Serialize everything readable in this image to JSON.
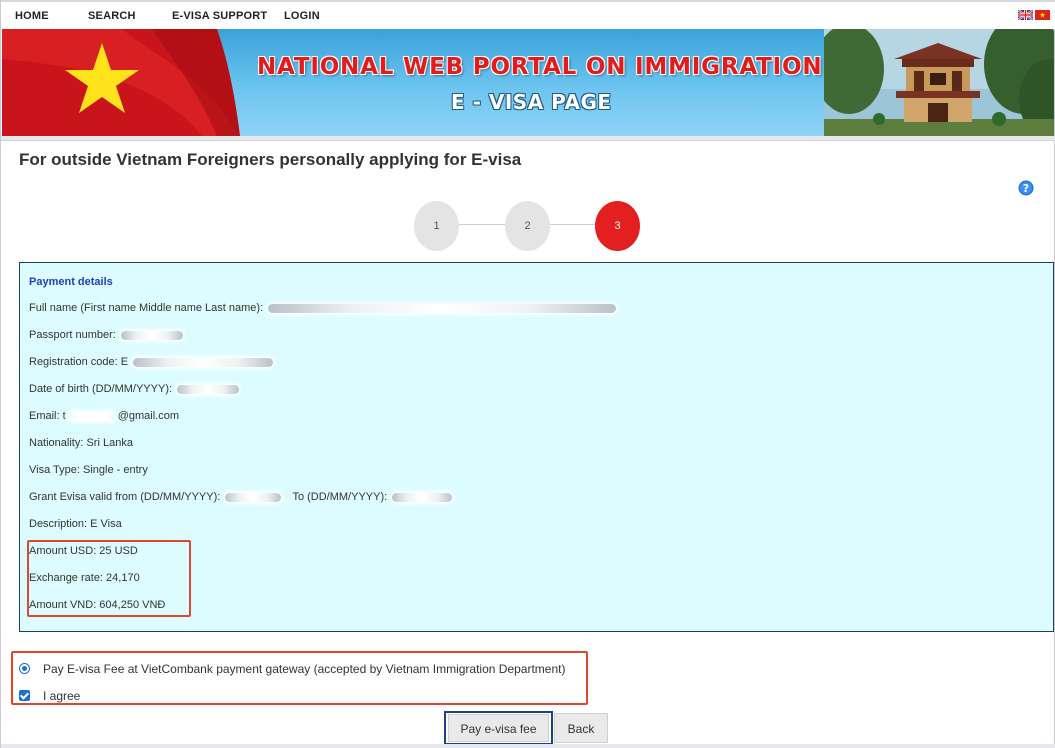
{
  "nav": {
    "home": "HOME",
    "search": "SEARCH",
    "support": "E-VISA SUPPORT",
    "login": "LOGIN"
  },
  "languages": [
    "english-flag-icon",
    "vietnam-flag-icon"
  ],
  "banner": {
    "title": "NATIONAL WEB PORTAL ON IMMIGRATION",
    "subtitle": "E - VISA PAGE"
  },
  "page": {
    "heading": "For outside Vietnam Foreigners personally applying for E-visa",
    "help_icon": "question-icon"
  },
  "steps": [
    {
      "label": "1",
      "active": false
    },
    {
      "label": "2",
      "active": false
    },
    {
      "label": "3",
      "active": true
    }
  ],
  "payment": {
    "title": "Payment details",
    "full_name_label": "Full name (First name Middle name Last name):",
    "passport_label": "Passport number:",
    "registration_label": "Registration code: E",
    "dob_label": "Date of birth (DD/MM/YYYY):",
    "email_label": "Email: t",
    "email_suffix": "@gmail.com",
    "nationality": "Nationality: Sri Lanka",
    "visa_type": "Visa Type: Single - entry",
    "grant_from_label": "Grant Evisa valid from (DD/MM/YYYY):",
    "grant_to_label": "To (DD/MM/YYYY):",
    "description": "Description: E Visa",
    "amount_usd": "Amount USD: 25 USD",
    "exchange_rate": "Exchange rate: 24,170",
    "amount_vnd": "Amount VND: 604,250 VNĐ"
  },
  "options": {
    "gateway_label": "Pay E-visa Fee at VietCombank payment gateway (accepted by Vietnam Immigration Department)",
    "gateway_selected": true,
    "agree_label": "I agree",
    "agree_checked": true
  },
  "buttons": {
    "pay": "Pay e-visa fee",
    "back": "Back"
  },
  "colors": {
    "accent_red": "#e41f1f",
    "payment_bg": "#ddfcff",
    "annotation_red": "#e0482e",
    "annotation_blue": "#1c3f8c"
  }
}
